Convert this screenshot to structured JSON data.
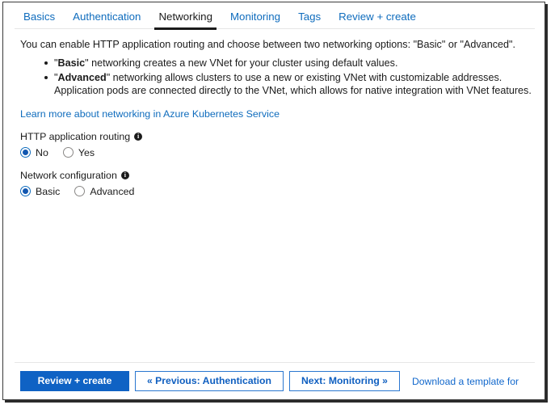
{
  "tabs": [
    {
      "label": "Basics",
      "active": false
    },
    {
      "label": "Authentication",
      "active": false
    },
    {
      "label": "Networking",
      "active": true
    },
    {
      "label": "Monitoring",
      "active": false
    },
    {
      "label": "Tags",
      "active": false
    },
    {
      "label": "Review + create",
      "active": false
    }
  ],
  "body": {
    "intro": "You can enable HTTP application routing and choose between two networking options: \"Basic\" or \"Advanced\".",
    "bullets": [
      {
        "lead_quote_open": "\"",
        "bold": "Basic",
        "rest": "\" networking creates a new VNet for your cluster using default values."
      },
      {
        "lead_quote_open": "\"",
        "bold": "Advanced",
        "rest": "\" networking allows clusters to use a new or existing VNet with customizable addresses. Application pods are connected directly to the VNet, which allows for native integration with VNet features."
      }
    ],
    "learn_more_link": "Learn more about networking in Azure Kubernetes Service"
  },
  "fields": [
    {
      "label": "HTTP application routing",
      "info_glyph": "i",
      "options": [
        {
          "label": "No",
          "selected": true
        },
        {
          "label": "Yes",
          "selected": false
        }
      ]
    },
    {
      "label": "Network configuration",
      "info_glyph": "i",
      "options": [
        {
          "label": "Basic",
          "selected": true
        },
        {
          "label": "Advanced",
          "selected": false
        }
      ]
    }
  ],
  "footer": {
    "review_create": "Review + create",
    "previous": "« Previous: Authentication",
    "next": "Next: Monitoring »",
    "download_template": "Download a template for"
  },
  "colors": {
    "accent": "#0f6cbd",
    "primary_button": "#0f62c4",
    "link": "#1268cc",
    "active_tab": "#1b1b1b"
  }
}
